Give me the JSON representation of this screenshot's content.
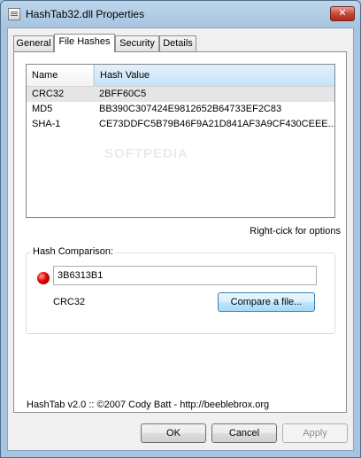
{
  "window": {
    "title": "HashTab32.dll Properties",
    "close_glyph": "✕"
  },
  "tabs": [
    {
      "label": "General",
      "active": false
    },
    {
      "label": "File Hashes",
      "active": true
    },
    {
      "label": "Security",
      "active": false
    },
    {
      "label": "Details",
      "active": false
    }
  ],
  "hash_list": {
    "columns": {
      "name": "Name",
      "value": "Hash Value"
    },
    "rows": [
      {
        "name": "CRC32",
        "value": "2BFF60C5"
      },
      {
        "name": "MD5",
        "value": "BB390C307424E9812652B64733EF2C83"
      },
      {
        "name": "SHA-1",
        "value": "CE73DDFC5B79B46F9A21D841AF3A9CF430CEEE..."
      }
    ]
  },
  "hint": "Right-cick for options",
  "hash_comparison": {
    "label": "Hash Comparison:",
    "input_value": "3B6313B1",
    "algorithm": "CRC32",
    "compare_button": "Compare a file...",
    "status_color": "#e00000"
  },
  "footer": "HashTab v2.0 :: ©2007 Cody Batt  -  http://beeblebrox.org",
  "watermark": "SOFTPEDIA",
  "buttons": {
    "ok": "OK",
    "cancel": "Cancel",
    "apply": "Apply"
  }
}
